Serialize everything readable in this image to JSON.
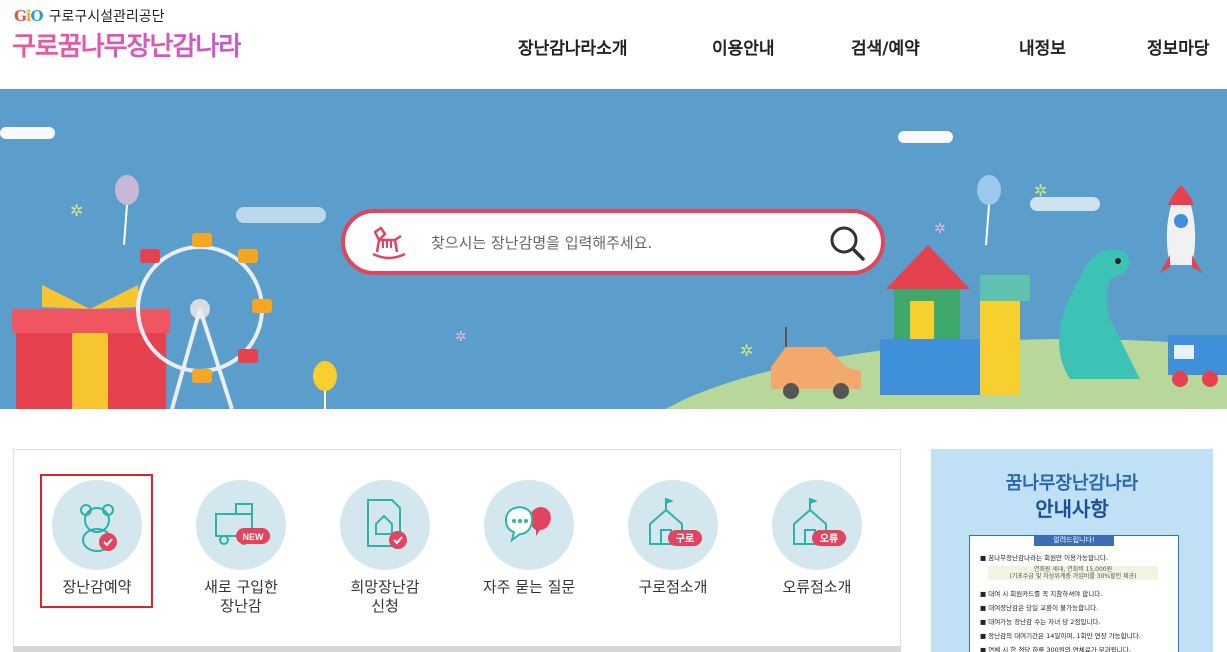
{
  "header": {
    "org_logo": "GiO",
    "org_name": "구로구시설관리공단",
    "brand": "구로꿈나무장난감나라"
  },
  "nav": [
    {
      "label": "장난감나라소개"
    },
    {
      "label": "이용안내"
    },
    {
      "label": "검색/예약"
    },
    {
      "label": "내정보"
    },
    {
      "label": "정보마당"
    }
  ],
  "search": {
    "placeholder": "찾으시는 장난감명을 입력해주세요."
  },
  "menu": [
    {
      "label": "장난감예약"
    },
    {
      "label": "새로 구입한\n장난감",
      "badge": "NEW"
    },
    {
      "label": "희망장난감\n신청"
    },
    {
      "label": "자주 묻는 질문"
    },
    {
      "label": "구로점소개",
      "badge": "구로"
    },
    {
      "label": "오류점소개",
      "badge": "오류"
    }
  ],
  "notice": {
    "title1": "꿈나무장난감나라",
    "title2": "안내사항",
    "head": "알려드립니다!",
    "line1": "■ 꿈나무장난감나라는 회원만 이용가능합니다.",
    "sub1": "연회원 세대, 연회비 15,000원",
    "sub2": "(기초수급 및 차상위계층 가입비를 30%할인 제공)",
    "line2": "■ 대여 시 회원카드를 꼭 지참하셔야 합니다.",
    "line3": "■ 대여장난감은 당일 교환이 불가능합니다.",
    "line4": "■ 대여가능 장난감 수는 자녀 당 2점입니다.",
    "line5": "■ 장난감의 대여기간은 14일이며, 1회만 연장 가능합니다.",
    "line6": "■ 연체 시 한 점당 하루 300원의 연체료가 부과됩니다."
  },
  "colors": {
    "banner_bg": "#5b9dcb",
    "search_border": "#e2435e",
    "menu_circle": "#d4e7ef",
    "selected_border": "#d9232d",
    "brand_pink": "#f0569a"
  }
}
